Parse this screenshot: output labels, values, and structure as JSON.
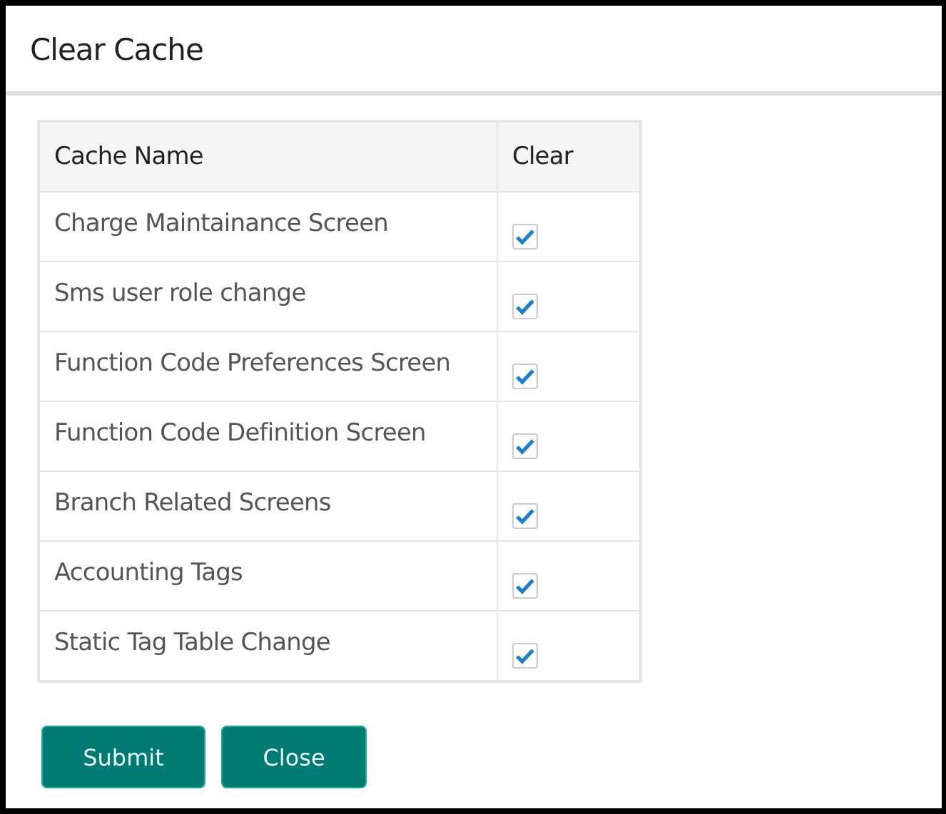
{
  "window": {
    "title": "Clear Cache"
  },
  "table": {
    "columns": [
      "Cache Name",
      "Clear"
    ],
    "rows": [
      {
        "name": "Charge Maintainance Screen",
        "checked": true
      },
      {
        "name": "Sms user role change",
        "checked": true
      },
      {
        "name": "Function Code Preferences Screen",
        "checked": true
      },
      {
        "name": "Function Code Definition Screen",
        "checked": true
      },
      {
        "name": "Branch Related Screens",
        "checked": true
      },
      {
        "name": "Accounting Tags",
        "checked": true
      },
      {
        "name": "Static Tag Table Change",
        "checked": true
      }
    ]
  },
  "buttons": [
    "Submit",
    "Close"
  ]
}
